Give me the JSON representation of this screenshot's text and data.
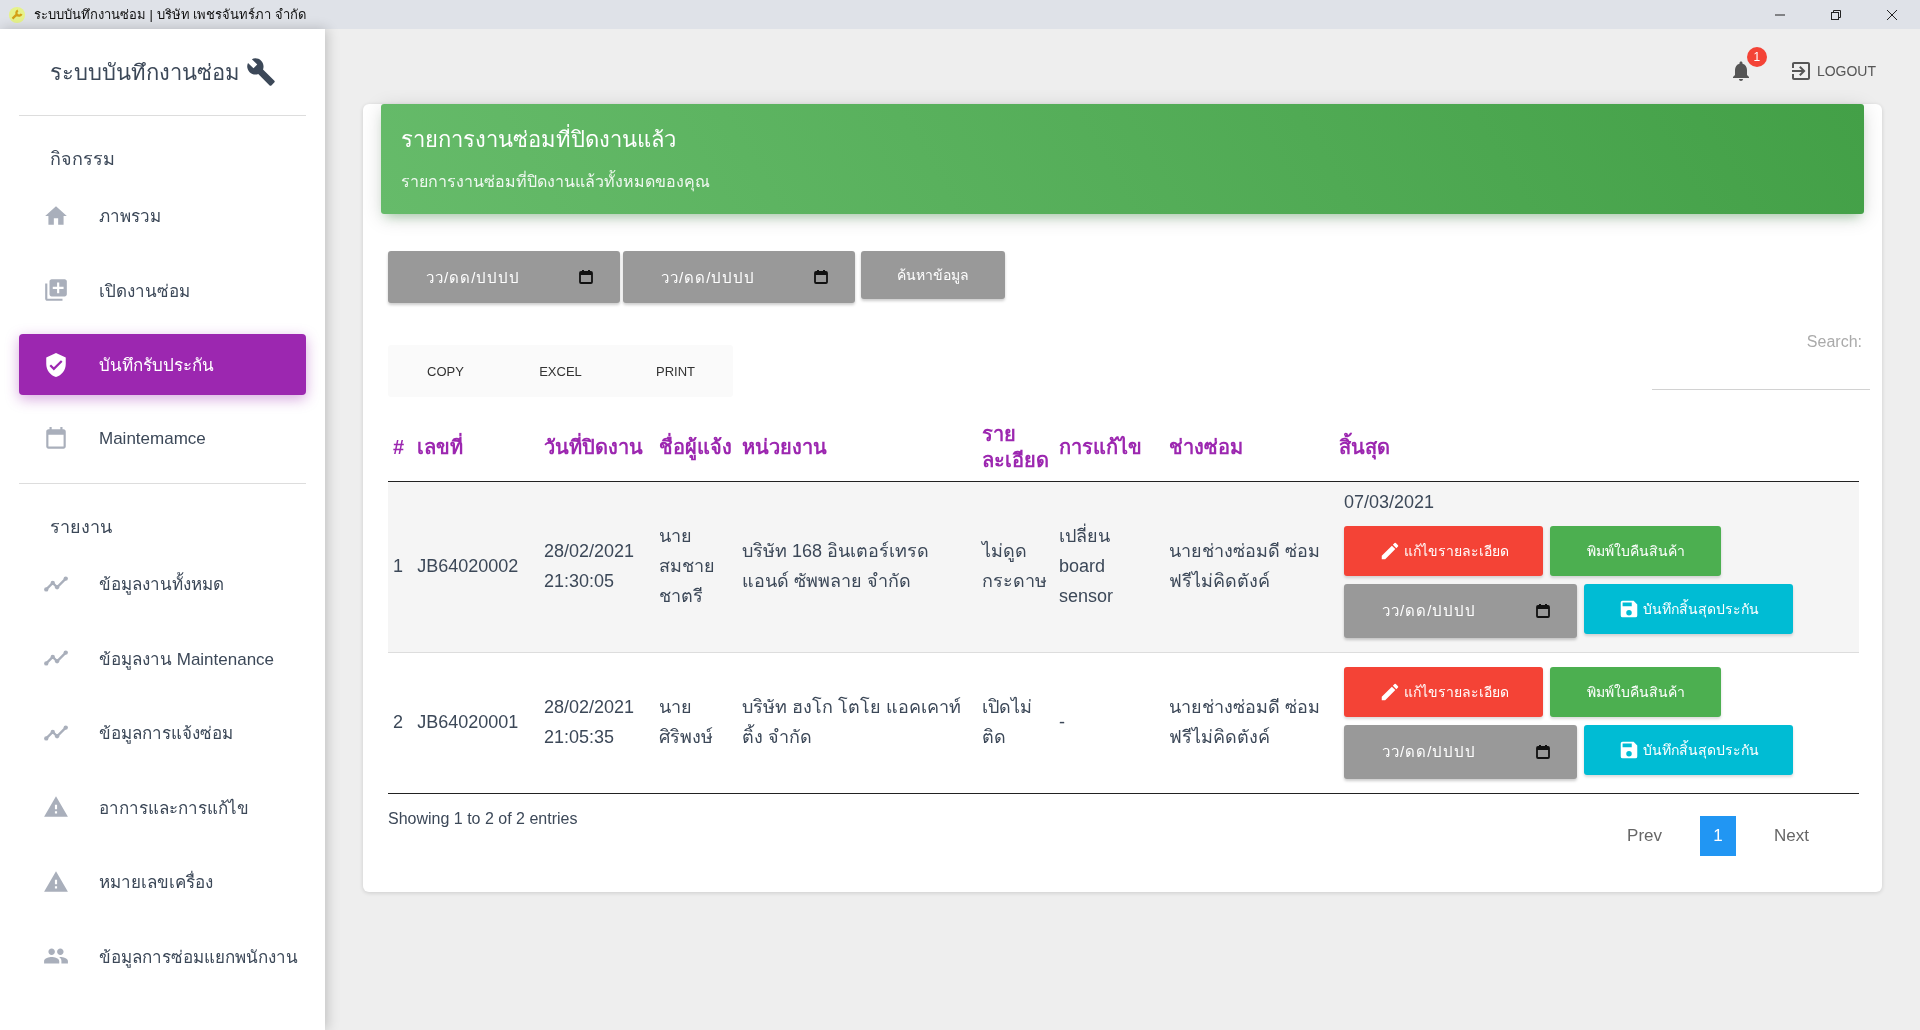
{
  "window": {
    "title": "ระบบบันทึกงานซ่อม | บริษัท เพชรจันทร์ภา จำกัด"
  },
  "sidebar": {
    "brand": "ระบบบันทึกงานซ่อม",
    "sections": [
      {
        "title": "กิจกรรม",
        "items": [
          {
            "label": "ภาพรวม",
            "kind": "home",
            "selected": false
          },
          {
            "label": "เปิดงานซ่อม",
            "kind": "add",
            "selected": false
          },
          {
            "label": "บันทึกรับประกัน",
            "kind": "shield",
            "selected": true
          },
          {
            "label": "Maintemamce",
            "kind": "calendar",
            "selected": false
          }
        ]
      },
      {
        "title": "รายงาน",
        "items": [
          {
            "label": "ข้อมูลงานทั้งหมด",
            "kind": "chart",
            "selected": false
          },
          {
            "label": "ข้อมูลงาน Maintenance",
            "kind": "chart",
            "selected": false
          },
          {
            "label": "ข้อมูลการแจ้งซ่อม",
            "kind": "chart",
            "selected": false
          },
          {
            "label": "อาการและการแก้ไข",
            "kind": "warning",
            "selected": false
          },
          {
            "label": "หมายเลขเครื่อง",
            "kind": "warning",
            "selected": false
          },
          {
            "label": "ข้อมูลการซ่อมแยกพนักงาน",
            "kind": "people",
            "selected": false
          }
        ]
      }
    ]
  },
  "topbar": {
    "notification_count": "1",
    "logout": "LOGOUT"
  },
  "header": {
    "title": "รายการงานซ่อมที่ปิดงานแล้ว",
    "subtitle": "รายการงานซ่อมที่ปิดงานแล้วทั้งหมดของคุณ"
  },
  "filters": {
    "date_from_placeholder": "วว/ดด/ปปปป",
    "date_to_placeholder": "วว/ดด/ปปปป",
    "search_button": "ค้นหาข้อมูล"
  },
  "export_buttons": [
    "COPY",
    "EXCEL",
    "PRINT"
  ],
  "search": {
    "label": "Search:"
  },
  "table": {
    "columns": [
      "#",
      "เลขที่",
      "วันที่ปิดงาน",
      "ชื่อผู้แจ้ง",
      "หน่วยงาน",
      "ราย ละเอียด",
      "การแก้ไข",
      "ช่างซ่อม",
      "สิ้นสุด"
    ],
    "rows": [
      {
        "index": "1",
        "number": "JB64020002",
        "closed": "28/02/2021 21:30:05",
        "reporter": "นาย สมชาย ชาตรี",
        "unit": "บริษัท 168 อินเตอร์เทรด แอนด์ ซัพพลาย จำกัด",
        "detail": "ไม่ดูด กระดาษ",
        "fix": "เปลี่ยน board sensor",
        "technician": "นายช่างซ่อมดี ซ่อมฟรีไม่คิดตังค์",
        "end_date": "07/03/2021",
        "edit_button": "แก้ไขรายละเอียด",
        "print_button": "พิมพ์ใบคืนสินค้า",
        "date_placeholder": "วว/ดด/ปปปป",
        "save_button": "บันทึกสิ้นสุดประกัน"
      },
      {
        "index": "2",
        "number": "JB64020001",
        "closed": "28/02/2021 21:05:35",
        "reporter": "นาย ศิริพงษ์",
        "unit": "บริษัท ฮงโก โตโย แอคเคาท์ติ้ง จำกัด",
        "detail": "เปิดไม่ ติด",
        "fix": "-",
        "technician": "นายช่างซ่อมดี ซ่อมฟรีไม่คิดตังค์",
        "edit_button": "แก้ไขรายละเอียด",
        "print_button": "พิมพ์ใบคืนสินค้า",
        "date_placeholder": "วว/ดด/ปปปป",
        "save_button": "บันทึกสิ้นสุดประกัน"
      }
    ]
  },
  "footer": {
    "info": "Showing 1 to 2 of 2 entries",
    "prev": "Prev",
    "pages": [
      {
        "label": "1",
        "selected": true
      }
    ],
    "next": "Next"
  }
}
